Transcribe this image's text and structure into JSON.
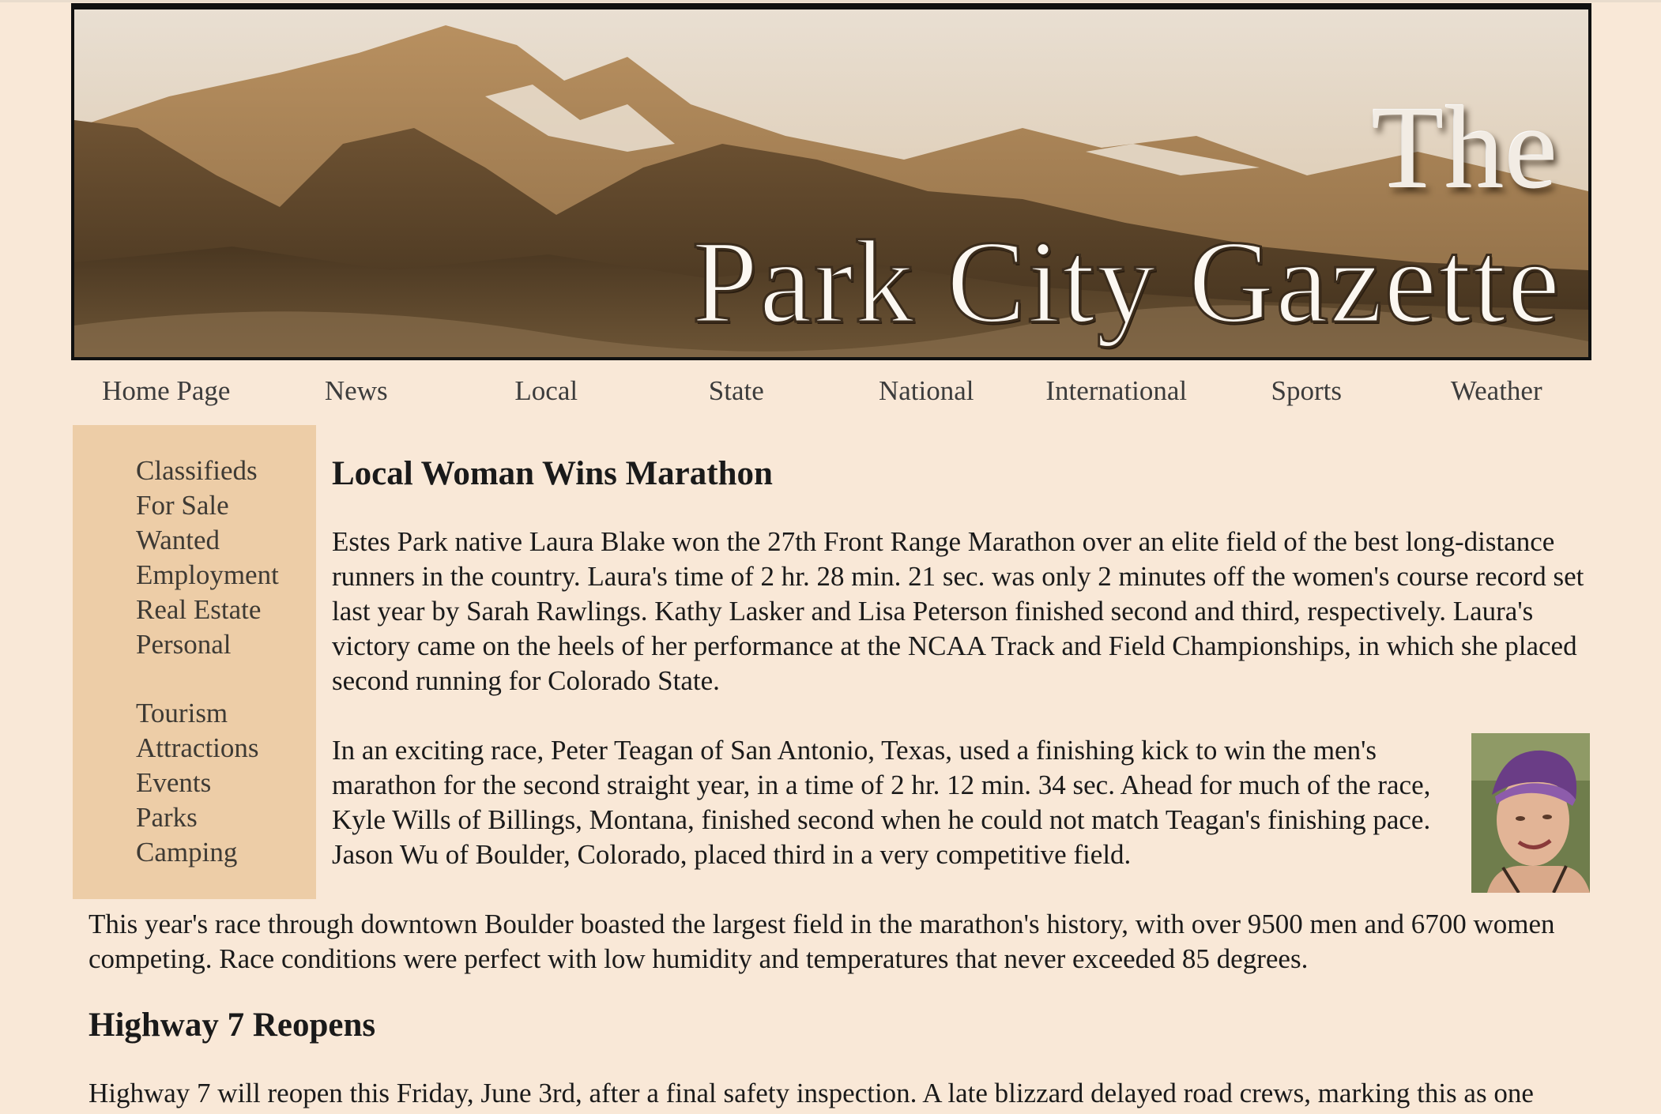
{
  "banner": {
    "title_line1": "The",
    "title_line2": "Park City Gazette"
  },
  "nav": {
    "items": [
      "Home Page",
      "News",
      "Local",
      "State",
      "National",
      "International",
      "Sports",
      "Weather"
    ]
  },
  "sidebar": {
    "classifieds": [
      "Classifieds",
      "For Sale",
      "Wanted",
      "Employment",
      "Real Estate",
      "Personal"
    ],
    "tourism": [
      "Tourism",
      "Attractions",
      "Events",
      "Parks",
      "Camping"
    ]
  },
  "article1": {
    "headline": "Local Woman Wins Marathon",
    "p1": "Estes Park native Laura Blake won the 27th Front Range Marathon over an elite field of the best long-distance runners in the country. Laura's time of 2 hr. 28 min. 21 sec. was only 2 minutes off the women's course record set last year by Sarah Rawlings. Kathy Lasker and Lisa Peterson finished second and third, respectively. Laura's victory came on the heels of her performance at the NCAA Track and Field Championships, in which she placed second running for Colorado State.",
    "p2": "In an exciting race, Peter Teagan of San Antonio, Texas, used a finishing kick to win the men's marathon for the second straight year, in a time of 2 hr. 12 min. 34 sec. Ahead for much of the race, Kyle Wills of Billings, Montana, finished second when he could not match Teagan's finishing pace. Jason Wu of Boulder, Colorado, placed third in a very competitive field.",
    "p3": "This year's race through downtown Boulder boasted the largest field in the marathon's history, with over 9500 men and 6700 women competing. Race conditions were perfect with low humidity and temperatures that never exceeded 85 degrees."
  },
  "article2": {
    "headline": "Highway 7 Reopens",
    "p1": "Highway 7 will reopen this Friday, June 3rd, after a final safety inspection. A late blizzard delayed road crews, marking this as one"
  },
  "colors": {
    "page_bg": "#f9e8d7",
    "sidebar_bg": "#edcda7"
  }
}
